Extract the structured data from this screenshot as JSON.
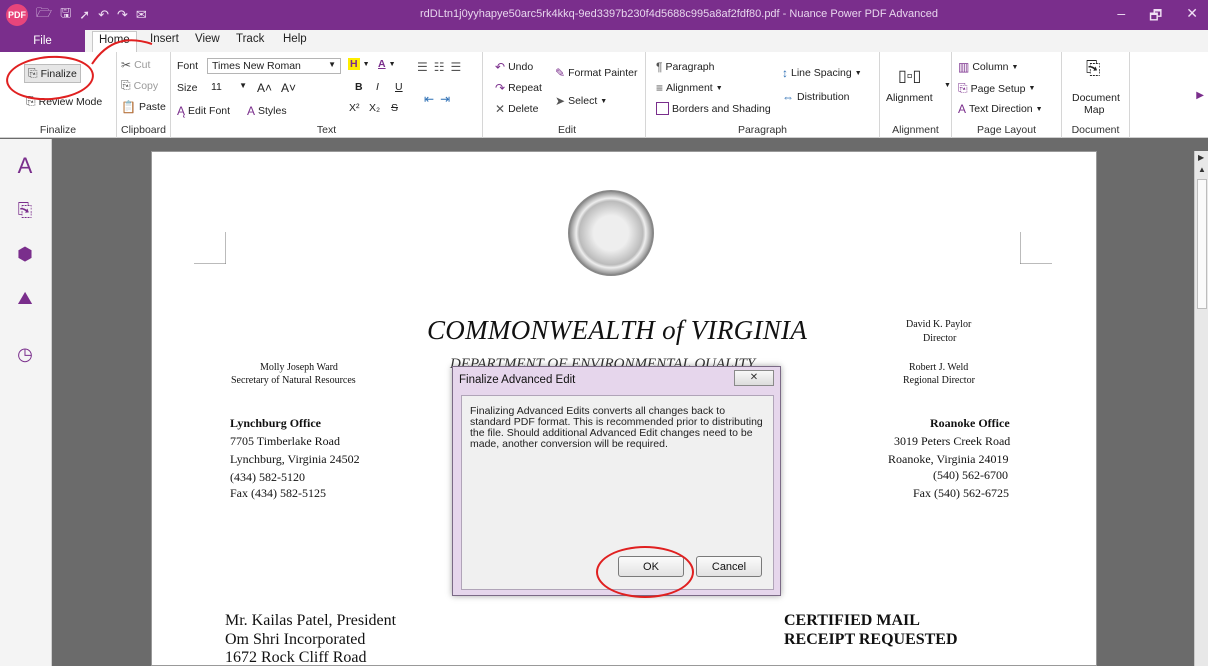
{
  "titlebar": {
    "logo": "PDF",
    "title": "rdDLtn1j0yyhapye50arc5rk4kkq-9ed3397b230f4d5688c995a8af2fdf80.pdf - Nuance Power PDF Advanced",
    "min": "–",
    "restore": "🗗",
    "close": "✕"
  },
  "tabs": {
    "file": "File",
    "home": "Home",
    "insert": "Insert",
    "view": "View",
    "track": "Track",
    "help": "Help"
  },
  "ribbon": {
    "finalize": {
      "finalize": "Finalize",
      "review_mode": "Review Mode",
      "label": "Finalize"
    },
    "clipboard": {
      "cut": "Cut",
      "copy": "Copy",
      "paste": "Paste",
      "label": "Clipboard"
    },
    "text": {
      "font_label": "Font",
      "font_value": "Times New Roman",
      "size_label": "Size",
      "size_value": "11",
      "highlight": "H",
      "font_color": "A",
      "bold": "B",
      "italic": "I",
      "underline": "U",
      "superscript": "X²",
      "subscript": "X₂",
      "strike": "S",
      "grow": "A˄",
      "shrink": "A˅",
      "edit_font": "Edit Font",
      "styles": "Styles",
      "label": "Text"
    },
    "edit": {
      "undo": "Undo",
      "repeat": "Repeat",
      "delete": "Delete",
      "format_painter": "Format Painter",
      "select": "Select",
      "label": "Edit"
    },
    "paragraph": {
      "paragraph": "Paragraph",
      "alignment": "Alignment",
      "borders": "Borders and Shading",
      "line_spacing": "Line Spacing",
      "distribution": "Distribution",
      "label": "Paragraph"
    },
    "alignment": {
      "alignment": "Alignment",
      "label": "Alignment"
    },
    "page_layout": {
      "column": "Column",
      "page_setup": "Page Setup",
      "text_direction": "Text Direction",
      "label": "Page Layout"
    },
    "document": {
      "doc_map_1": "Document",
      "doc_map_2": "Map",
      "label": "Document"
    }
  },
  "document": {
    "heading": "COMMONWEALTH of VIRGINIA",
    "subheading": "DEPARTMENT OF ENVIRONMENTAL QUALITY",
    "left_name": "Molly Joseph Ward",
    "left_title": "Secretary of Natural Resources",
    "right_name1": "David K. Paylor",
    "right_title1": "Director",
    "right_name2": "Robert J. Weld",
    "right_title2": "Regional Director",
    "lynchburg": [
      "Lynchburg Office",
      "7705 Timberlake Road",
      "Lynchburg, Virginia 24502",
      "(434) 582-5120",
      "Fax (434) 582-5125"
    ],
    "roanoke": [
      "Roanoke Office",
      "3019 Peters Creek Road",
      "Roanoke, Virginia 24019",
      "(540) 562-6700",
      "Fax (540) 562-6725"
    ],
    "addressee": [
      "Mr. Kailas Patel, President",
      "Om Shri Incorporated",
      "1672 Rock Cliff Road"
    ],
    "certified1": "CERTIFIED MAIL",
    "certified2": "RECEIPT REQUESTED"
  },
  "dialog": {
    "title": "Finalize Advanced Edit",
    "close": "✕",
    "message": "Finalizing Advanced Edits converts all changes back to standard PDF format.  This is recommended prior to distributing the file. Should additional Advanced Edit changes need to be made, another conversion will be required.",
    "ok": "OK",
    "cancel": "Cancel"
  },
  "colors": {
    "accent": "#7a2e8c",
    "annotation": "#e02020"
  }
}
